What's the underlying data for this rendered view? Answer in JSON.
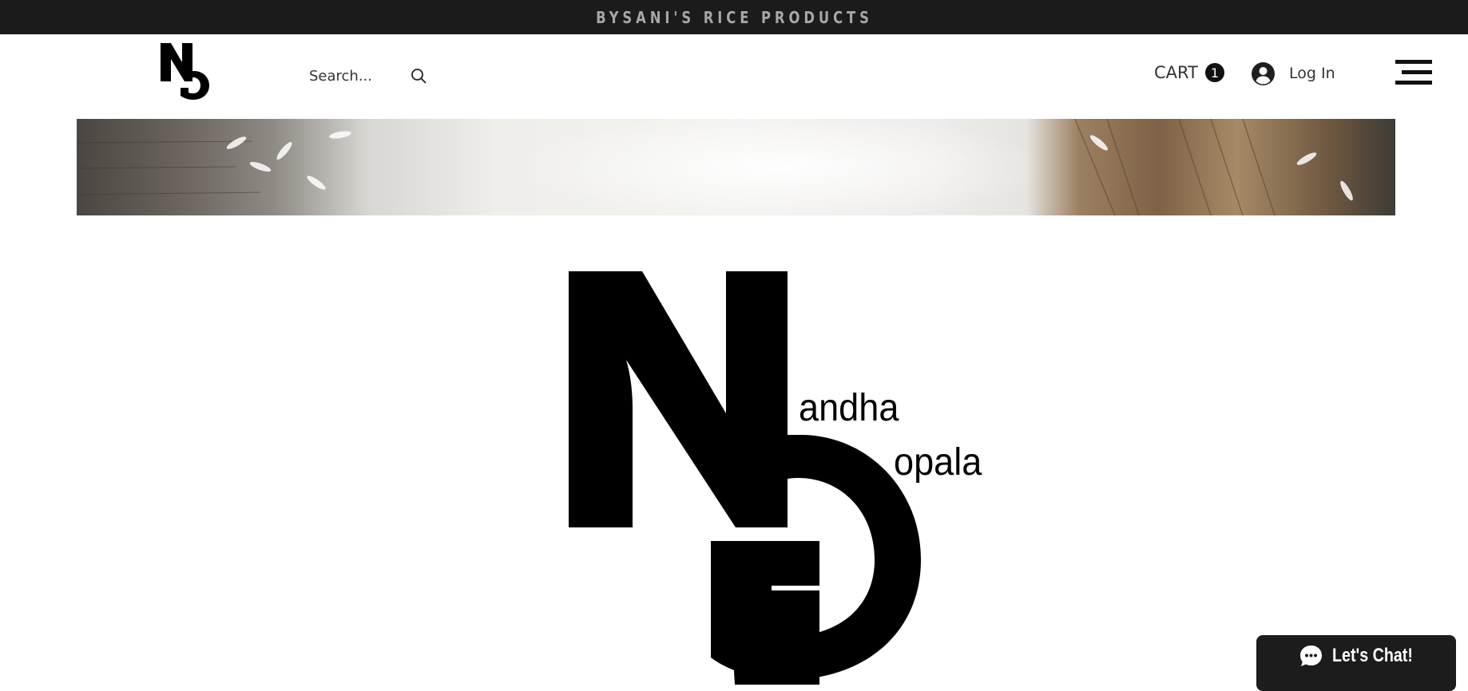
{
  "announcement": {
    "text": "BYSANI'S RICE PRODUCTS"
  },
  "header": {
    "logo_letters": "NG",
    "search": {
      "placeholder": "Search..."
    },
    "cart": {
      "label": "CART",
      "count": "1"
    },
    "login": {
      "label": "Log In"
    }
  },
  "banner": {
    "image": "rice-grains-and-burlap-sack-photo"
  },
  "hero": {
    "logo_letters": "NG",
    "brand_line1": "andha",
    "brand_line2": "opala"
  },
  "chat": {
    "label": "Let's Chat!"
  },
  "colors": {
    "announcement_bg": "#1b1b1b",
    "announcement_text": "#a7a7a7",
    "chat_bg": "#1c1c1c",
    "logo": "#000000"
  },
  "icons": [
    "ng-logo-icon",
    "search-icon",
    "user-avatar-icon",
    "hamburger-menu-icon",
    "chat-bubble-icon"
  ]
}
